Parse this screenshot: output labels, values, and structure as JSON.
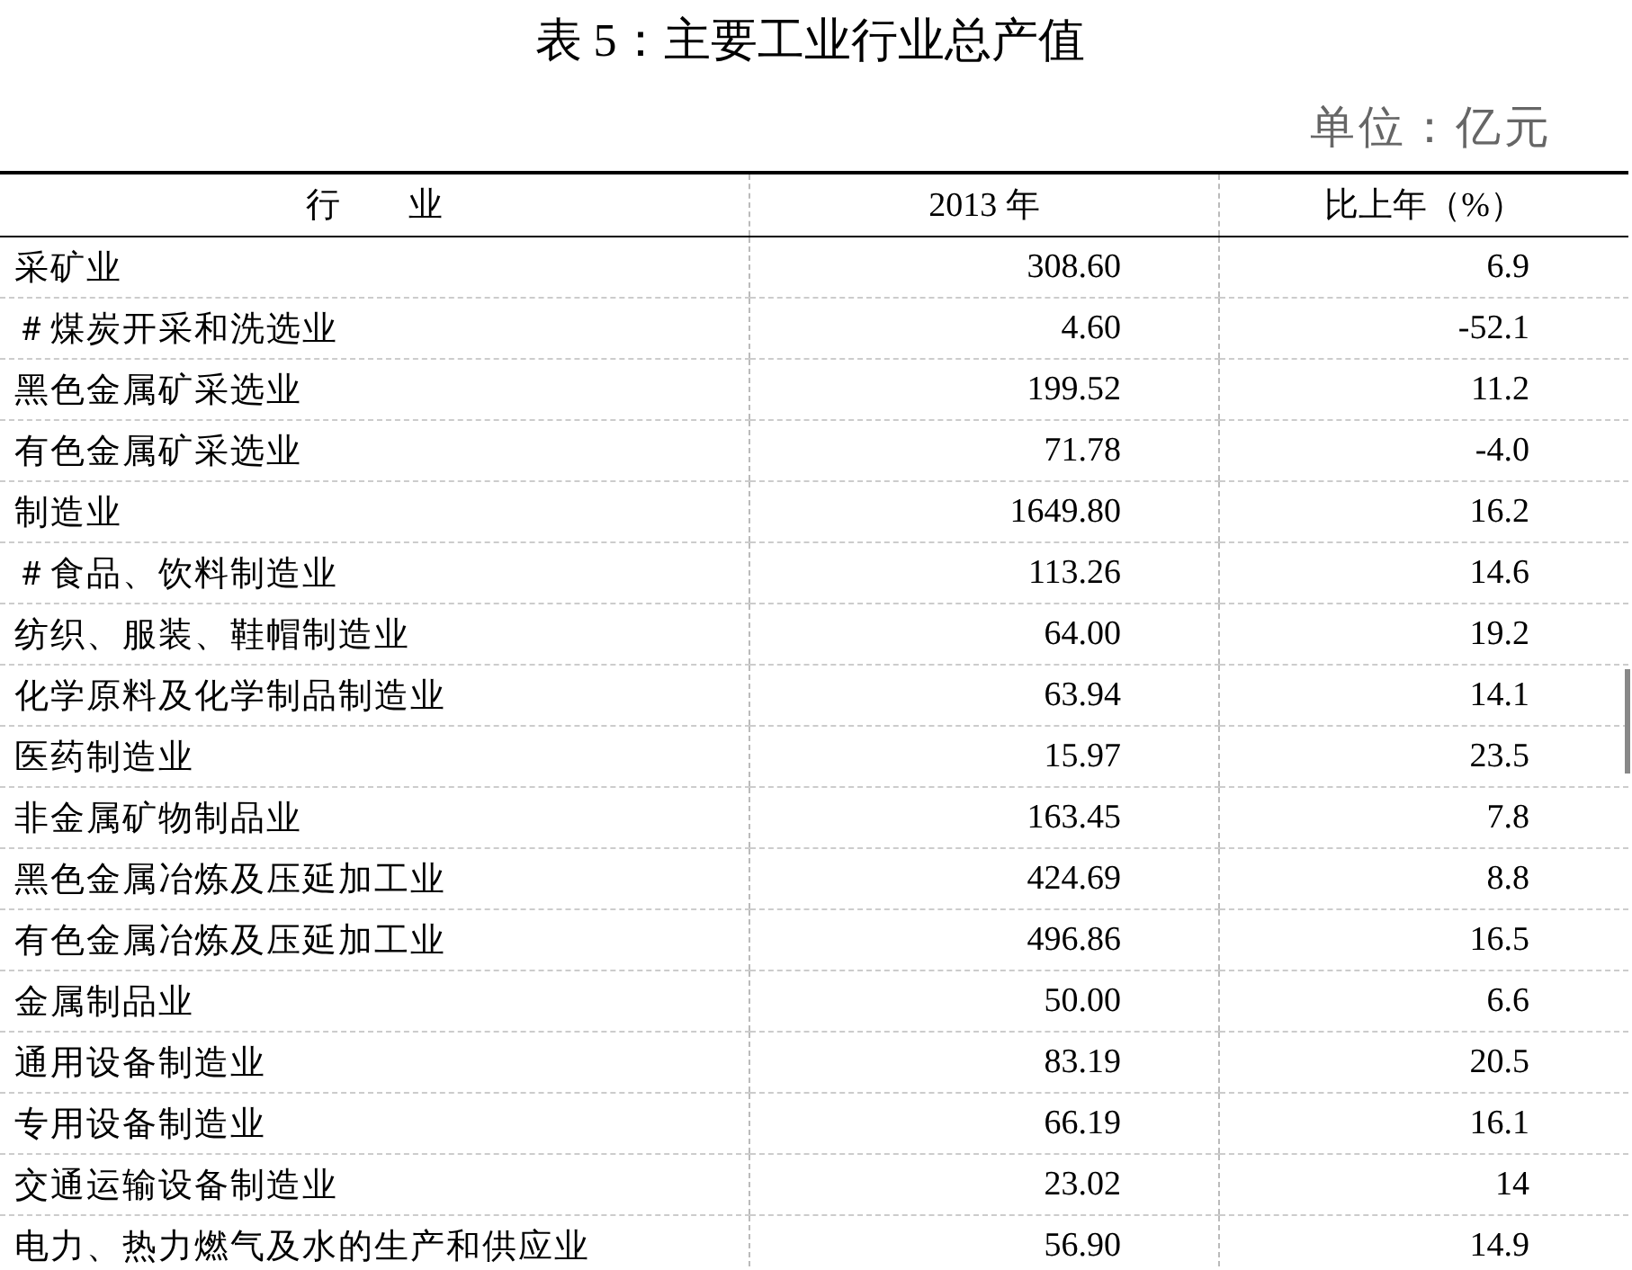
{
  "title": "表 5：主要工业行业总产值",
  "unit": "单位：亿元",
  "table": {
    "columns": [
      "行　　业",
      "2013 年",
      "比上年（%）"
    ],
    "rows": [
      [
        "采矿业",
        "308.60",
        "6.9"
      ],
      [
        "＃煤炭开采和洗选业",
        "4.60",
        "-52.1"
      ],
      [
        "黑色金属矿采选业",
        "199.52",
        "11.2"
      ],
      [
        "有色金属矿采选业",
        "71.78",
        "-4.0"
      ],
      [
        "制造业",
        "1649.80",
        "16.2"
      ],
      [
        "＃食品、饮料制造业",
        "113.26",
        "14.6"
      ],
      [
        "纺织、服装、鞋帽制造业",
        "64.00",
        "19.2"
      ],
      [
        "化学原料及化学制品制造业",
        "63.94",
        "14.1"
      ],
      [
        "医药制造业",
        "15.97",
        "23.5"
      ],
      [
        "非金属矿物制品业",
        "163.45",
        "7.8"
      ],
      [
        "黑色金属冶炼及压延加工业",
        "424.69",
        "8.8"
      ],
      [
        "有色金属冶炼及压延加工业",
        "496.86",
        "16.5"
      ],
      [
        "金属制品业",
        "50.00",
        "6.6"
      ],
      [
        "通用设备制造业",
        "83.19",
        "20.5"
      ],
      [
        "专用设备制造业",
        "66.19",
        "16.1"
      ],
      [
        "交通运输设备制造业",
        "23.02",
        "14"
      ],
      [
        "电力、热力燃气及水的生产和供应业",
        "56.90",
        "14.9"
      ]
    ]
  }
}
